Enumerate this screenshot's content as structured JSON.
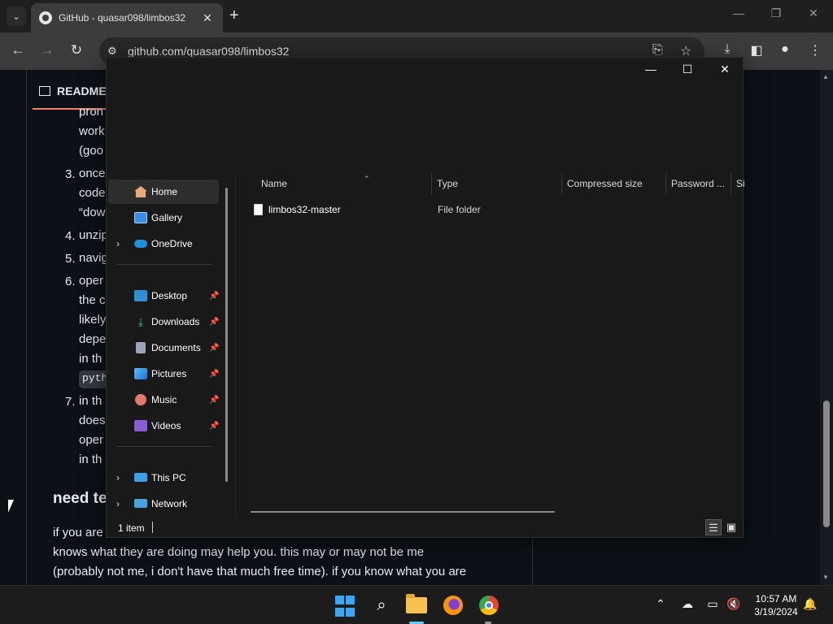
{
  "browser": {
    "tab_title": "GitHub - quasar098/limbos32",
    "url": "github.com/quasar098/limbos32",
    "tab_menu_icon": "chevron-down-icon",
    "close_tab_glyph": "✕",
    "new_tab_glyph": "+"
  },
  "readme": {
    "tab_label": "README",
    "lines": [
      {
        "text": "pron"
      },
      {
        "text": "work"
      },
      {
        "text": "(goo"
      },
      {
        "text": "once"
      },
      {
        "text": "code"
      },
      {
        "text": "“dow"
      },
      {
        "text": "unzip"
      },
      {
        "text": "navig"
      },
      {
        "text": "oper"
      },
      {
        "text": "the c"
      },
      {
        "text": "likely"
      },
      {
        "text": "depe"
      },
      {
        "text": "in th"
      },
      {
        "text": "in th"
      },
      {
        "text": "does"
      },
      {
        "text": "oper"
      },
      {
        "text": "in th"
      }
    ],
    "numbers": [
      "3.",
      "4.",
      "5.",
      "6.",
      "7."
    ],
    "code_chip": "pyth",
    "heading": "need te",
    "paragraph": [
      "if you are",
      "knows what they are doing may help you. this may or may not be me",
      "(probably not me, i don't have that much free time). if you know what you are"
    ]
  },
  "explorer": {
    "nav": {
      "home": "Home",
      "gallery": "Gallery",
      "onedrive": "OneDrive",
      "desktop": "Desktop",
      "downloads": "Downloads",
      "documents": "Documents",
      "pictures": "Pictures",
      "music": "Music",
      "videos": "Videos",
      "this_pc": "This PC",
      "network": "Network"
    },
    "columns": {
      "name": "Name",
      "type": "Type",
      "compressed_size": "Compressed size",
      "password": "Password ...",
      "size": "Si"
    },
    "files": [
      {
        "name": "limbos32-master",
        "type": "File folder"
      }
    ],
    "status": "1 item"
  },
  "taskbar": {
    "time": "10:57 AM",
    "date": "3/19/2024"
  },
  "colors": {
    "accent": "#60cdff",
    "github_link_underline": "#f78166",
    "explorer_bg": "#191919"
  }
}
